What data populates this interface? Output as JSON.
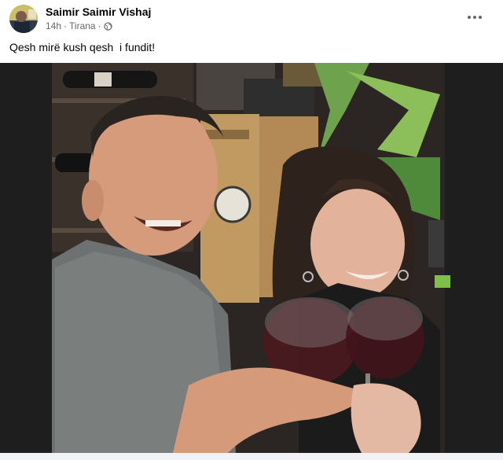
{
  "post": {
    "author": "Saimir Saimir Vishaj",
    "time": "14h",
    "separator": "·",
    "location": "Tirana",
    "caption": "Qesh mirë kush qesh  i fundit!"
  },
  "icons": {
    "globe": "globe-icon",
    "more": "more-options-icon"
  },
  "colors": {
    "name": "#050505",
    "meta": "#65676b",
    "photo_background": "#1f1f1f"
  }
}
